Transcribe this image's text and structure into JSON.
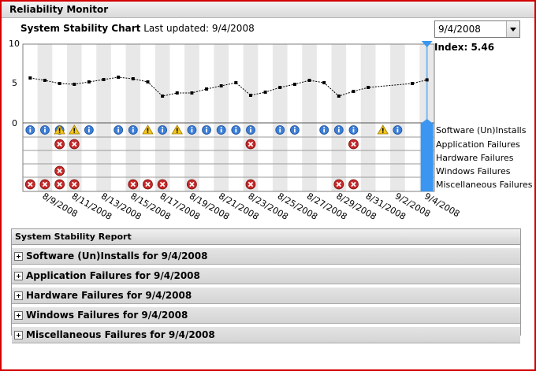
{
  "window": {
    "title": "Reliability Monitor"
  },
  "header": {
    "chart_title": "System Stability Chart",
    "last_updated": "Last updated: 9/4/2008"
  },
  "date_selector": {
    "value": "9/4/2008"
  },
  "index": {
    "label": "Index: 5.46"
  },
  "y_axis": {
    "ticks": [
      "10",
      "5",
      "0"
    ]
  },
  "row_labels": [
    "Software (Un)Installs",
    "Application Failures",
    "Hardware Failures",
    "Windows Failures",
    "Miscellaneous Failures"
  ],
  "x_axis": {
    "tick_labels": [
      "8/9/2008",
      "8/11/2008",
      "8/13/2008",
      "8/15/2008",
      "8/17/2008",
      "8/19/2008",
      "8/21/2008",
      "8/23/2008",
      "8/25/2008",
      "8/27/2008",
      "8/29/2008",
      "8/31/2008",
      "9/2/2008",
      "9/4/2008"
    ]
  },
  "chart_data": {
    "type": "line",
    "title": "System Stability Chart",
    "ylim": [
      0,
      10
    ],
    "x": [
      "8/8/2008",
      "8/9/2008",
      "8/10/2008",
      "8/11/2008",
      "8/12/2008",
      "8/13/2008",
      "8/14/2008",
      "8/15/2008",
      "8/16/2008",
      "8/17/2008",
      "8/18/2008",
      "8/19/2008",
      "8/20/2008",
      "8/21/2008",
      "8/22/2008",
      "8/23/2008",
      "8/24/2008",
      "8/25/2008",
      "8/26/2008",
      "8/27/2008",
      "8/28/2008",
      "8/29/2008",
      "8/30/2008",
      "8/31/2008",
      "9/1/2008",
      "9/2/2008",
      "9/3/2008",
      "9/4/2008"
    ],
    "values": [
      5.7,
      5.4,
      5.0,
      4.9,
      5.2,
      5.5,
      5.8,
      5.6,
      5.2,
      3.4,
      3.8,
      3.8,
      4.3,
      4.7,
      5.1,
      3.5,
      3.9,
      4.5,
      4.9,
      5.4,
      5.1,
      3.4,
      4.0,
      4.5,
      5.0,
      5.46
    ],
    "value_dates": [
      "8/8/2008",
      "8/9/2008",
      "8/10/2008",
      "8/11/2008",
      "8/12/2008",
      "8/13/2008",
      "8/14/2008",
      "8/15/2008",
      "8/16/2008",
      "8/17/2008",
      "8/18/2008",
      "8/19/2008",
      "8/20/2008",
      "8/21/2008",
      "8/22/2008",
      "8/23/2008",
      "8/24/2008",
      "8/25/2008",
      "8/26/2008",
      "8/27/2008",
      "8/28/2008",
      "8/29/2008",
      "8/30/2008",
      "8/31/2008",
      "9/3/2008",
      "9/4/2008"
    ],
    "selected_date": "9/4/2008",
    "events": {
      "software_installs": {
        "info": [
          "8/8/2008",
          "8/9/2008",
          "8/10/2008",
          "8/12/2008",
          "8/14/2008",
          "8/15/2008",
          "8/17/2008",
          "8/19/2008",
          "8/20/2008",
          "8/21/2008",
          "8/22/2008",
          "8/23/2008",
          "8/25/2008",
          "8/26/2008",
          "8/28/2008",
          "8/29/2008",
          "8/30/2008",
          "9/2/2008"
        ],
        "warning": [
          "8/10/2008",
          "8/11/2008",
          "8/16/2008",
          "8/18/2008",
          "9/1/2008"
        ]
      },
      "application_failures": [
        "8/10/2008",
        "8/11/2008",
        "8/23/2008",
        "8/30/2008"
      ],
      "hardware_failures": [],
      "windows_failures": [
        "8/10/2008"
      ],
      "miscellaneous_failures": [
        "8/8/2008",
        "8/9/2008",
        "8/10/2008",
        "8/11/2008",
        "8/15/2008",
        "8/16/2008",
        "8/17/2008",
        "8/19/2008",
        "8/23/2008",
        "8/29/2008",
        "8/30/2008"
      ]
    }
  },
  "report": {
    "title": "System Stability Report",
    "items": [
      {
        "label": "Software (Un)Installs for 9/4/2008"
      },
      {
        "label": "Application Failures for 9/4/2008"
      },
      {
        "label": "Hardware Failures for 9/4/2008"
      },
      {
        "label": "Windows Failures for 9/4/2008"
      },
      {
        "label": "Miscellaneous Failures for 9/4/2008"
      }
    ]
  },
  "colors": {
    "frame": "#d40000",
    "selection": "#3a96f0",
    "error": "#c62828",
    "info": "#2f6fd0",
    "warning": "#f0c000"
  }
}
